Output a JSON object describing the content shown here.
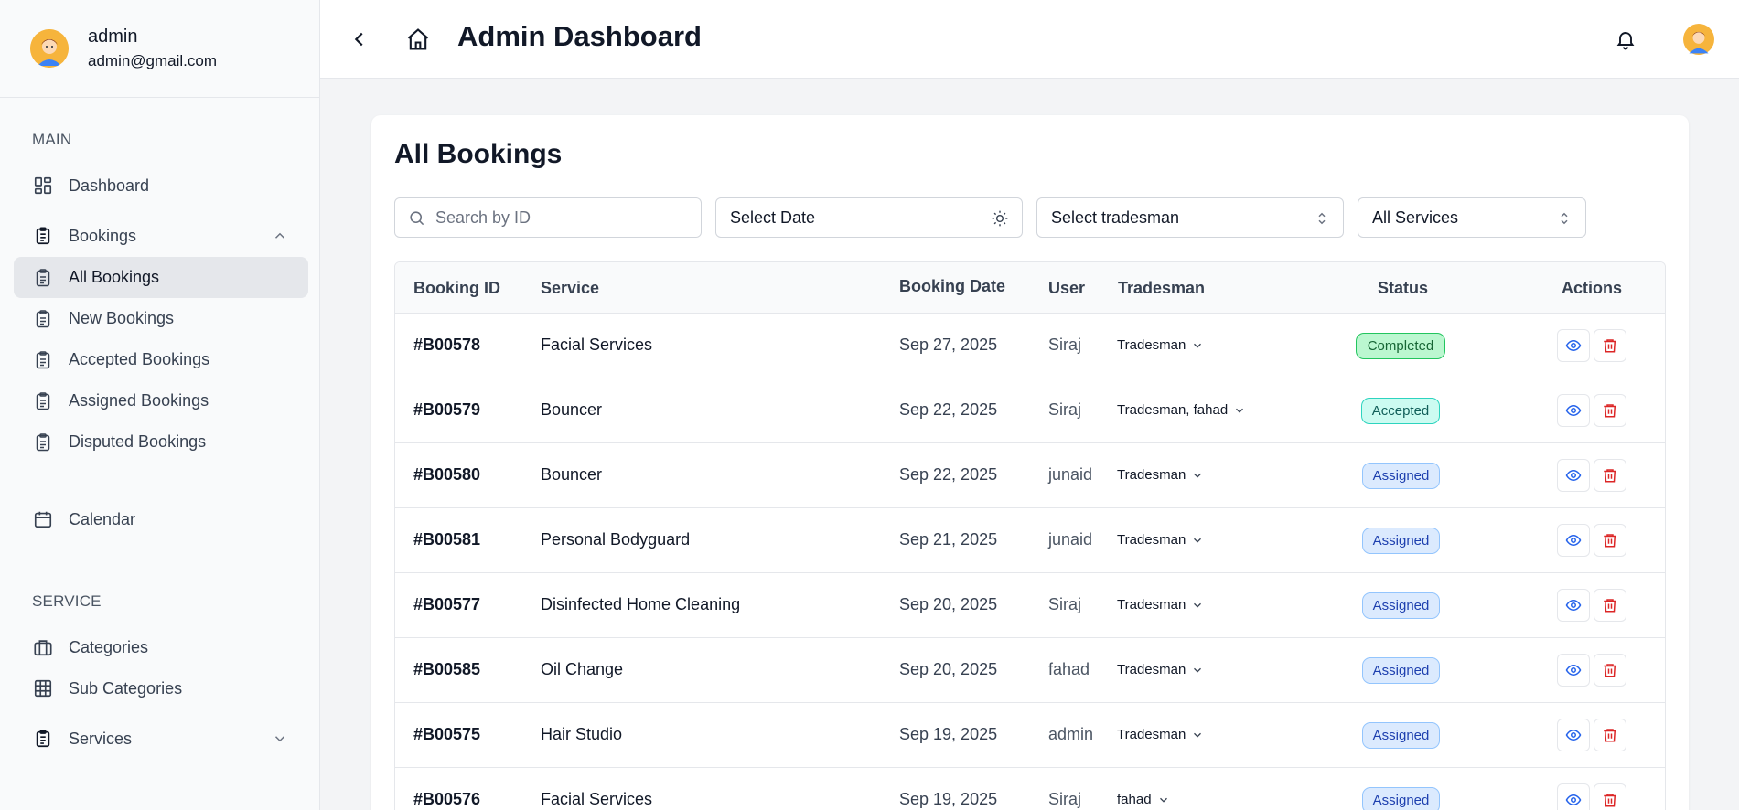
{
  "colors": {
    "accent": "#2563eb",
    "danger": "#dc2626",
    "active_bg": "#e5e7eb"
  },
  "user": {
    "name": "admin",
    "email": "admin@gmail.com"
  },
  "sidebar": {
    "main_label": "MAIN",
    "dashboard": "Dashboard",
    "bookings": "Bookings",
    "booking_items": [
      "All Bookings",
      "New Bookings",
      "Accepted Bookings",
      "Assigned Bookings",
      "Disputed Bookings"
    ],
    "calendar": "Calendar",
    "service_label": "SERVICE",
    "categories": "Categories",
    "sub_categories": "Sub Categories",
    "services": "Services"
  },
  "header": {
    "title": "Admin Dashboard"
  },
  "main": {
    "title": "All Bookings",
    "filters": {
      "search_placeholder": "Search by ID",
      "date": "Select Date",
      "tradesman": "Select tradesman",
      "services": "All Services"
    },
    "columns": [
      "Booking ID",
      "Service",
      "Booking Date",
      "User",
      "Tradesman",
      "Status",
      "Actions"
    ],
    "rows": [
      {
        "id": "#B00578",
        "service": "Facial Services",
        "date": "Sep 27, 2025",
        "user": "Siraj",
        "tradesman": "Tradesman",
        "status": "Completed",
        "status_key": "completed"
      },
      {
        "id": "#B00579",
        "service": "Bouncer",
        "date": "Sep 22, 2025",
        "user": "Siraj",
        "tradesman": "Tradesman, fahad",
        "status": "Accepted",
        "status_key": "accepted"
      },
      {
        "id": "#B00580",
        "service": "Bouncer",
        "date": "Sep 22, 2025",
        "user": "junaid",
        "tradesman": "Tradesman",
        "status": "Assigned",
        "status_key": "assigned"
      },
      {
        "id": "#B00581",
        "service": "Personal Bodyguard",
        "date": "Sep 21, 2025",
        "user": "junaid",
        "tradesman": "Tradesman",
        "status": "Assigned",
        "status_key": "assigned"
      },
      {
        "id": "#B00577",
        "service": "Disinfected Home Cleaning",
        "date": "Sep 20, 2025",
        "user": "Siraj",
        "tradesman": "Tradesman",
        "status": "Assigned",
        "status_key": "assigned"
      },
      {
        "id": "#B00585",
        "service": "Oil Change",
        "date": "Sep 20, 2025",
        "user": "fahad",
        "tradesman": "Tradesman",
        "status": "Assigned",
        "status_key": "assigned"
      },
      {
        "id": "#B00575",
        "service": "Hair Studio",
        "date": "Sep 19, 2025",
        "user": "admin",
        "tradesman": "Tradesman",
        "status": "Assigned",
        "status_key": "assigned"
      },
      {
        "id": "#B00576",
        "service": "Facial Services",
        "date": "Sep 19, 2025",
        "user": "Siraj",
        "tradesman": "fahad",
        "status": "Assigned",
        "status_key": "assigned"
      }
    ]
  }
}
